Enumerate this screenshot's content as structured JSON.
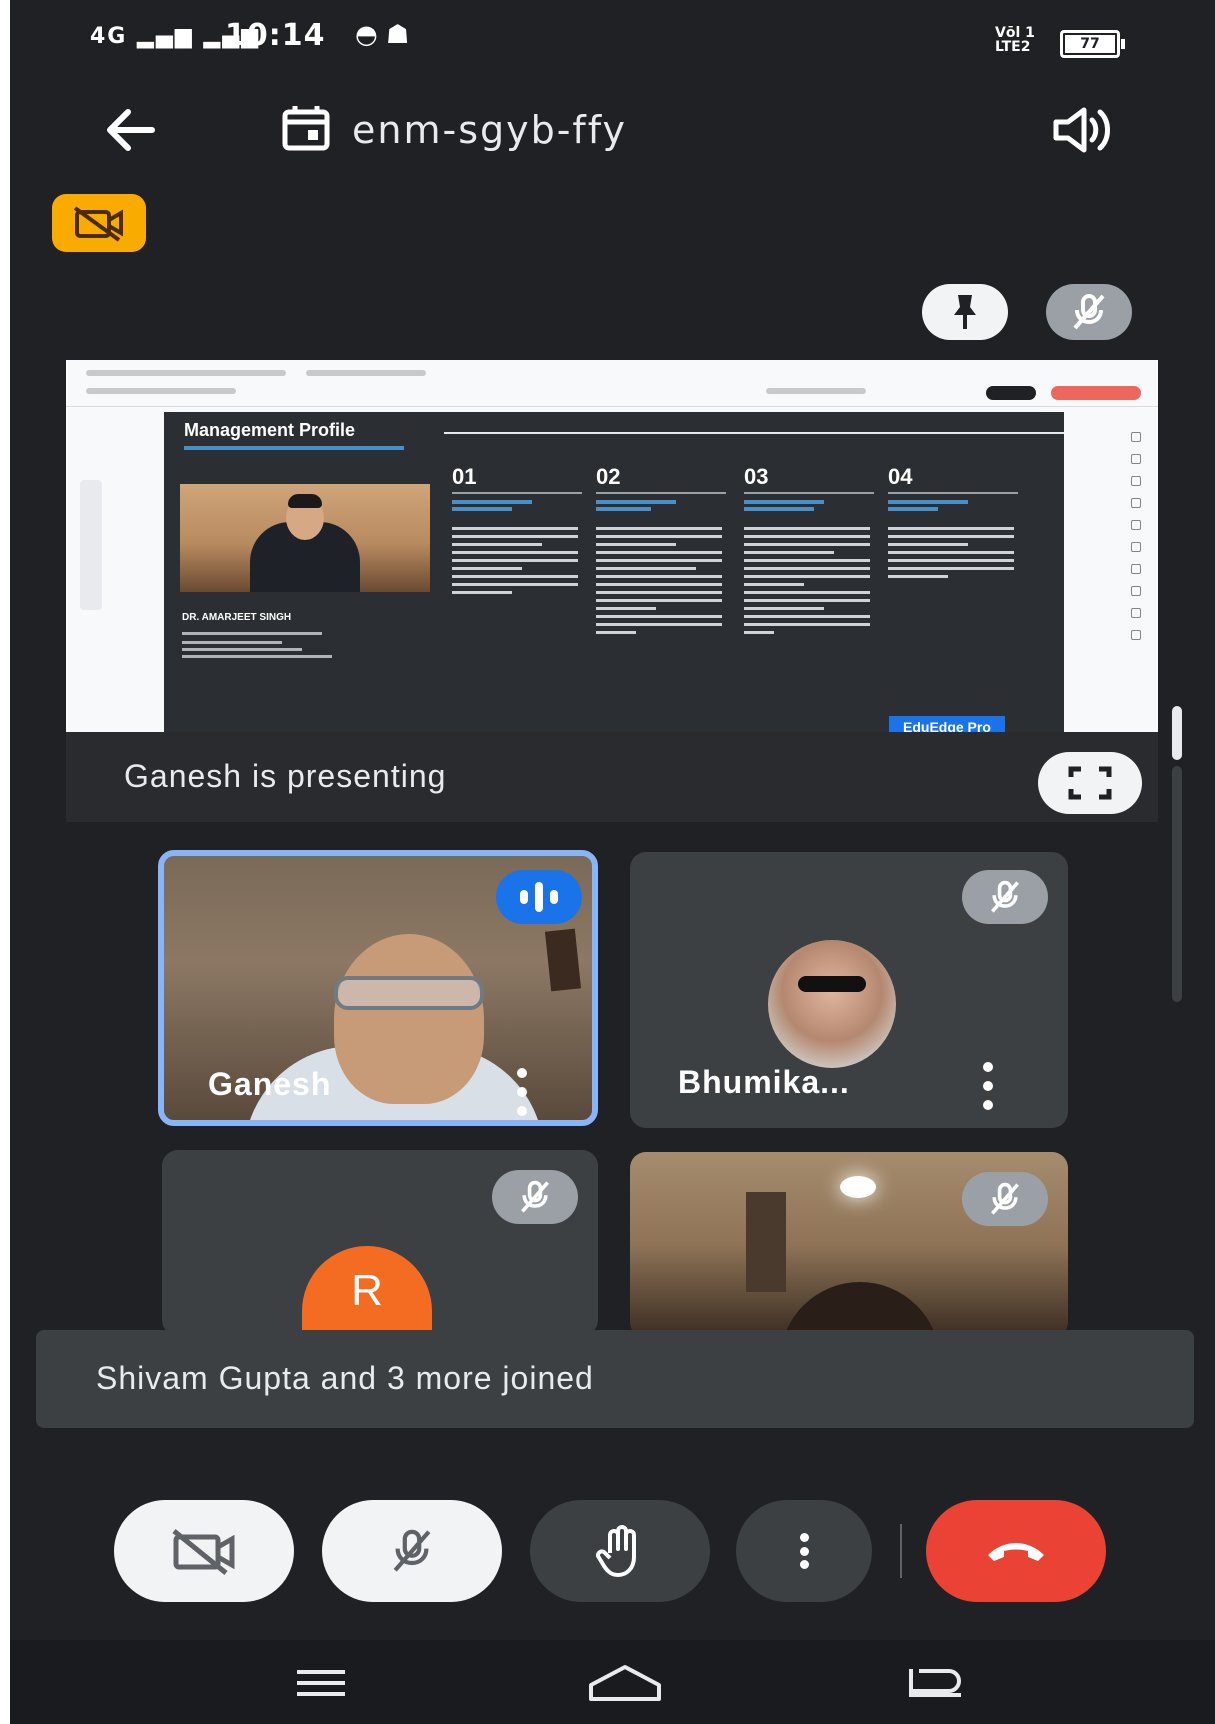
{
  "status_bar": {
    "network": "4G",
    "time": "10:14",
    "lte_label_1": "Vōl 1",
    "lte_label_2": "LTE2",
    "battery": "77"
  },
  "header": {
    "meeting_code": "enm-sgyb-ffy"
  },
  "icons": {
    "back": "arrow-left-icon",
    "calendar": "calendar-icon",
    "speaker": "speaker-icon",
    "recording": "camera-off-icon",
    "pin": "pin-icon",
    "mic_off": "mic-off-icon",
    "fullscreen": "fullscreen-icon",
    "raise_hand": "hand-icon",
    "end_call": "phone-hangup-icon"
  },
  "shared_screen": {
    "slide_title": "Management Profile",
    "person_name": "DR. AMARJEET SINGH",
    "columns": [
      "01",
      "02",
      "03",
      "04"
    ],
    "brand": "EduEdge Pro"
  },
  "presenting": {
    "text": "Ganesh  is presenting"
  },
  "participants": [
    {
      "name": "Ganesh",
      "state": "speaking"
    },
    {
      "name": "Bhumika...",
      "state": "muted"
    },
    {
      "name": "",
      "initial": "R",
      "state": "muted"
    },
    {
      "name": "",
      "state": "muted"
    }
  ],
  "toast": {
    "text": "Shivam Gupta and 3 more joined"
  },
  "colors": {
    "background": "#202124",
    "tile": "#3c4043",
    "speaking_border": "#8ab4f8",
    "speaking_badge": "#1a73e8",
    "end_call": "#ea4335",
    "avatar_r": "#f36c21",
    "recording_badge": "#f9ab00"
  }
}
